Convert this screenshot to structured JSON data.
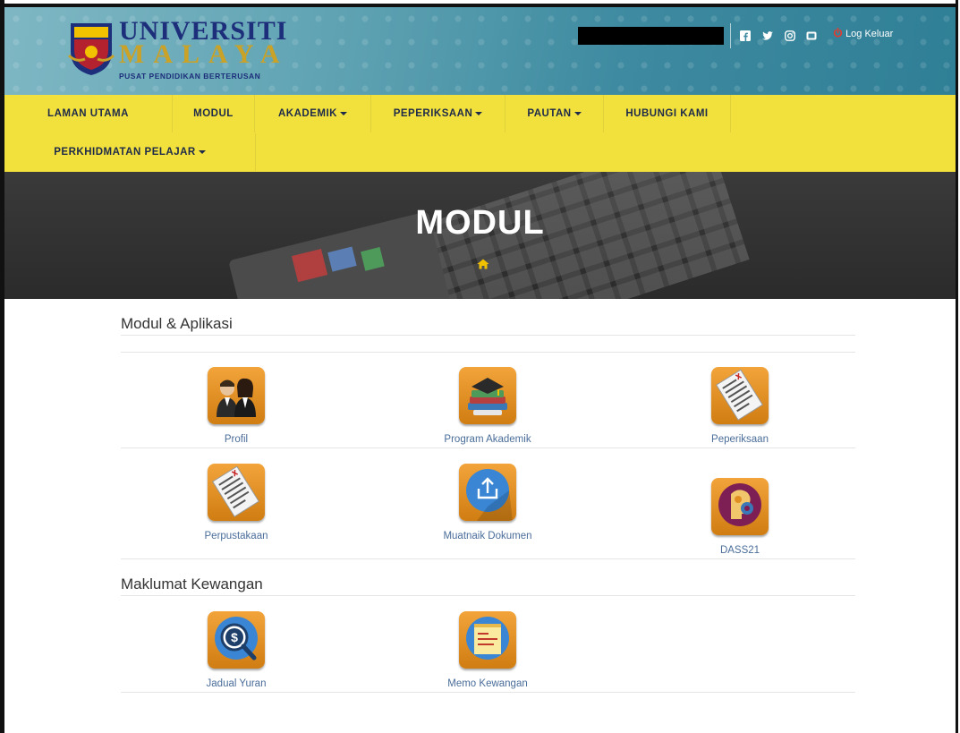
{
  "header": {
    "logo_title": "UNIVERSITI",
    "logo_sub_title": "MALAYA",
    "logo_tagline": "PUSAT PENDIDIKAN BERTERUSAN",
    "social_icons": [
      "facebook-icon",
      "twitter-icon",
      "instagram-icon",
      "youtube-icon"
    ],
    "logout_label": "Log Keluar",
    "logout_icon": "power-icon"
  },
  "nav": {
    "items": [
      {
        "label": "LAMAN UTAMA",
        "dropdown": false
      },
      {
        "label": "MODUL",
        "dropdown": false
      },
      {
        "label": "AKADEMIK",
        "dropdown": true
      },
      {
        "label": "PEPERIKSAAN",
        "dropdown": true
      },
      {
        "label": "PAUTAN",
        "dropdown": true
      },
      {
        "label": "HUBUNGI KAMI",
        "dropdown": false
      },
      {
        "label": "PERKHIDMATAN PELAJAR",
        "dropdown": true
      }
    ]
  },
  "banner": {
    "title": "MODUL",
    "breadcrumb_icon": "home-icon"
  },
  "sections": [
    {
      "title": "Modul & Aplikasi",
      "modules": [
        {
          "label": "Profil",
          "icon": "profile-icon"
        },
        {
          "label": "Program Akademik",
          "icon": "books-icon"
        },
        {
          "label": "Peperiksaan",
          "icon": "exam-sheet-icon"
        },
        {
          "label": "Perpustakaan",
          "icon": "library-sheet-icon"
        },
        {
          "label": "Muatnaik Dokumen",
          "icon": "upload-icon"
        },
        {
          "label": "DASS21",
          "icon": "mind-gear-icon"
        }
      ]
    },
    {
      "title": "Maklumat Kewangan",
      "modules": [
        {
          "label": "Jadual Yuran",
          "icon": "fee-search-icon"
        },
        {
          "label": "Memo Kewangan",
          "icon": "memo-icon"
        }
      ]
    }
  ],
  "colors": {
    "nav_bg": "#f2e13c",
    "header_bg": "#3e8aa0",
    "tile_bg": "#e08f22",
    "link": "#4a6d9a",
    "logout_icon": "#e23b2e"
  }
}
